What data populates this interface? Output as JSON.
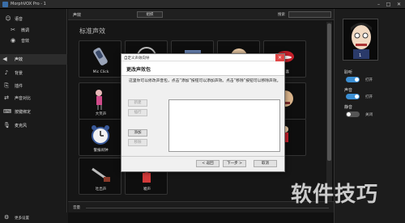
{
  "window": {
    "title": "MorphVOX Pro - 1"
  },
  "sidebar": {
    "items": [
      {
        "label": "语音",
        "icon": "person-icon"
      },
      {
        "label": "微调",
        "icon": "tools-icon"
      },
      {
        "label": "音效",
        "icon": "eye-icon"
      },
      {
        "label": "声效",
        "icon": "speaker-icon",
        "active": true
      },
      {
        "label": "背景",
        "icon": "music-note-icon"
      },
      {
        "label": "插件",
        "icon": "plugin-icon"
      },
      {
        "label": "声音对比",
        "icon": "compare-icon"
      },
      {
        "label": "按键绑定",
        "icon": "keyboard-icon"
      },
      {
        "label": "麦克风",
        "icon": "microphone-icon"
      }
    ],
    "bottom_label": "更多设置"
  },
  "main": {
    "section": "声效",
    "combo_label": "组织",
    "search_label": "搜索",
    "grid_title": "标准声效",
    "tiles": [
      {
        "label": "Mic Click",
        "art": "mic"
      },
      {
        "label": "",
        "art": "circle"
      },
      {
        "label": "",
        "art": "box"
      },
      {
        "label": "",
        "art": "face"
      },
      {
        "label": "简喜",
        "art": "lips"
      },
      {
        "label": "大笑声",
        "art": "figure"
      },
      {
        "label": "",
        "art": "blank"
      },
      {
        "label": "",
        "art": "blank"
      },
      {
        "label": "",
        "art": "blank"
      },
      {
        "label": "",
        "art": "face2"
      },
      {
        "label": "警报闹钟",
        "art": "clock"
      },
      {
        "label": "",
        "art": "blank"
      },
      {
        "label": "",
        "art": "blank"
      },
      {
        "label": "",
        "art": "blank"
      },
      {
        "label": "",
        "art": "figure2"
      },
      {
        "label": "吐出声",
        "art": "pump"
      },
      {
        "label": "嘘声",
        "art": "redfig"
      }
    ],
    "volume_label": "音量"
  },
  "right_panel": {
    "avatar_number": "1",
    "toggles": [
      {
        "label": "聆听",
        "state": "on",
        "text": "打开"
      },
      {
        "label": "声音",
        "state": "on",
        "text": "打开"
      },
      {
        "label": "静音",
        "state": "off",
        "text": "关闭"
      }
    ]
  },
  "dialog": {
    "title": "自定义声效向导",
    "close": "✕",
    "header": "更改声效包",
    "description": "这里你可以修改声音包，点击“添加”按钮可以添加声效。点击“移除”按钮可以移除声效。",
    "side_buttons": [
      {
        "label": "新建",
        "enabled": false
      },
      {
        "label": "插行",
        "enabled": false
      },
      {
        "label": "添加",
        "enabled": true
      },
      {
        "label": "移除",
        "enabled": false
      }
    ],
    "footer_buttons": [
      "< 返回",
      "下一步 >",
      "取消"
    ]
  },
  "watermark": "软件技巧",
  "colors": {
    "accent": "#3b8fd4",
    "close": "#e04848"
  }
}
